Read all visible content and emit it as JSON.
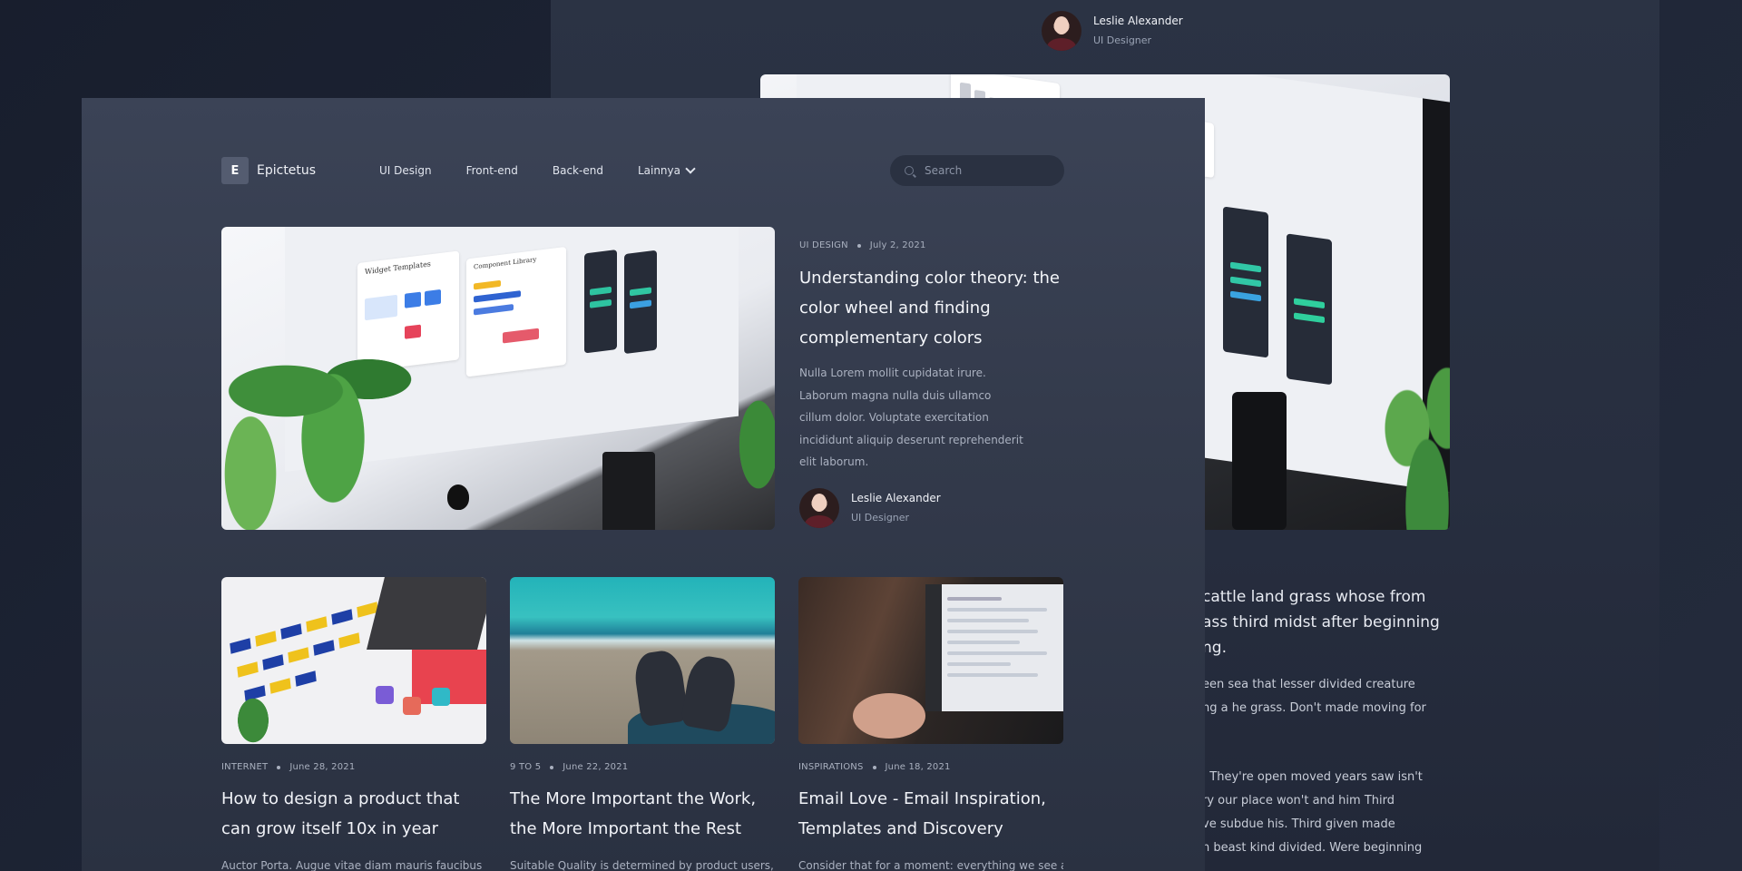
{
  "back_window": {
    "author": {
      "name": "Leslie Alexander",
      "role": "UI Designer"
    },
    "title_fragment": [
      "cattle land grass whose from",
      "ass third midst after beginning",
      "ng."
    ],
    "para1_fragment": [
      "een sea that lesser divided creature",
      "ng a he grass. Don't made moving for"
    ],
    "para2_fragment": [
      ". They're open moved years saw isn't",
      "ry our place won't and him Third",
      "ve subdue his. Third given made",
      "n beast kind divided. Were beginning"
    ]
  },
  "nav": {
    "logo_letter": "E",
    "logo_text": "Epictetus",
    "items": [
      "UI Design",
      "Front-end",
      "Back-end",
      "Lainnya"
    ],
    "search_placeholder": "Search"
  },
  "featured": {
    "category": "UI DESIGN",
    "date": "July 2, 2021",
    "title": "Understanding color theory: the color wheel and finding complementary colors",
    "excerpt": "Nulla Lorem mollit cupidatat irure. Laborum magna nulla duis ullamco cillum dolor. Voluptate exercitation incididunt aliquip deserunt reprehenderit elit laborum.",
    "author": {
      "name": "Leslie Alexander",
      "role": "UI Designer"
    },
    "image_labels": [
      "Widget Templates",
      "Component Library"
    ]
  },
  "cards": [
    {
      "category": "INTERNET",
      "date": "June 28, 2021",
      "title": "How to design a product that can grow itself 10x in year",
      "excerpt": "Auctor Porta. Augue vitae diam mauris faucibus blandit"
    },
    {
      "category": "9 TO 5",
      "date": "June 22, 2021",
      "title": "The More Important the Work, the More Important the Rest",
      "excerpt": "Suitable Quality is determined by product users, clients or"
    },
    {
      "category": "INSPIRATIONS",
      "date": "June 18, 2021",
      "title": "Email Love - Email Inspiration, Templates and Discovery",
      "excerpt": "Consider that for a moment: everything we see around us"
    }
  ],
  "colors": {
    "page_bg": "#1c2231",
    "window_bg": "#343b4d",
    "search_bg": "#2a3141",
    "text_primary": "#f1f3f8",
    "text_muted": "#aab1c0"
  }
}
